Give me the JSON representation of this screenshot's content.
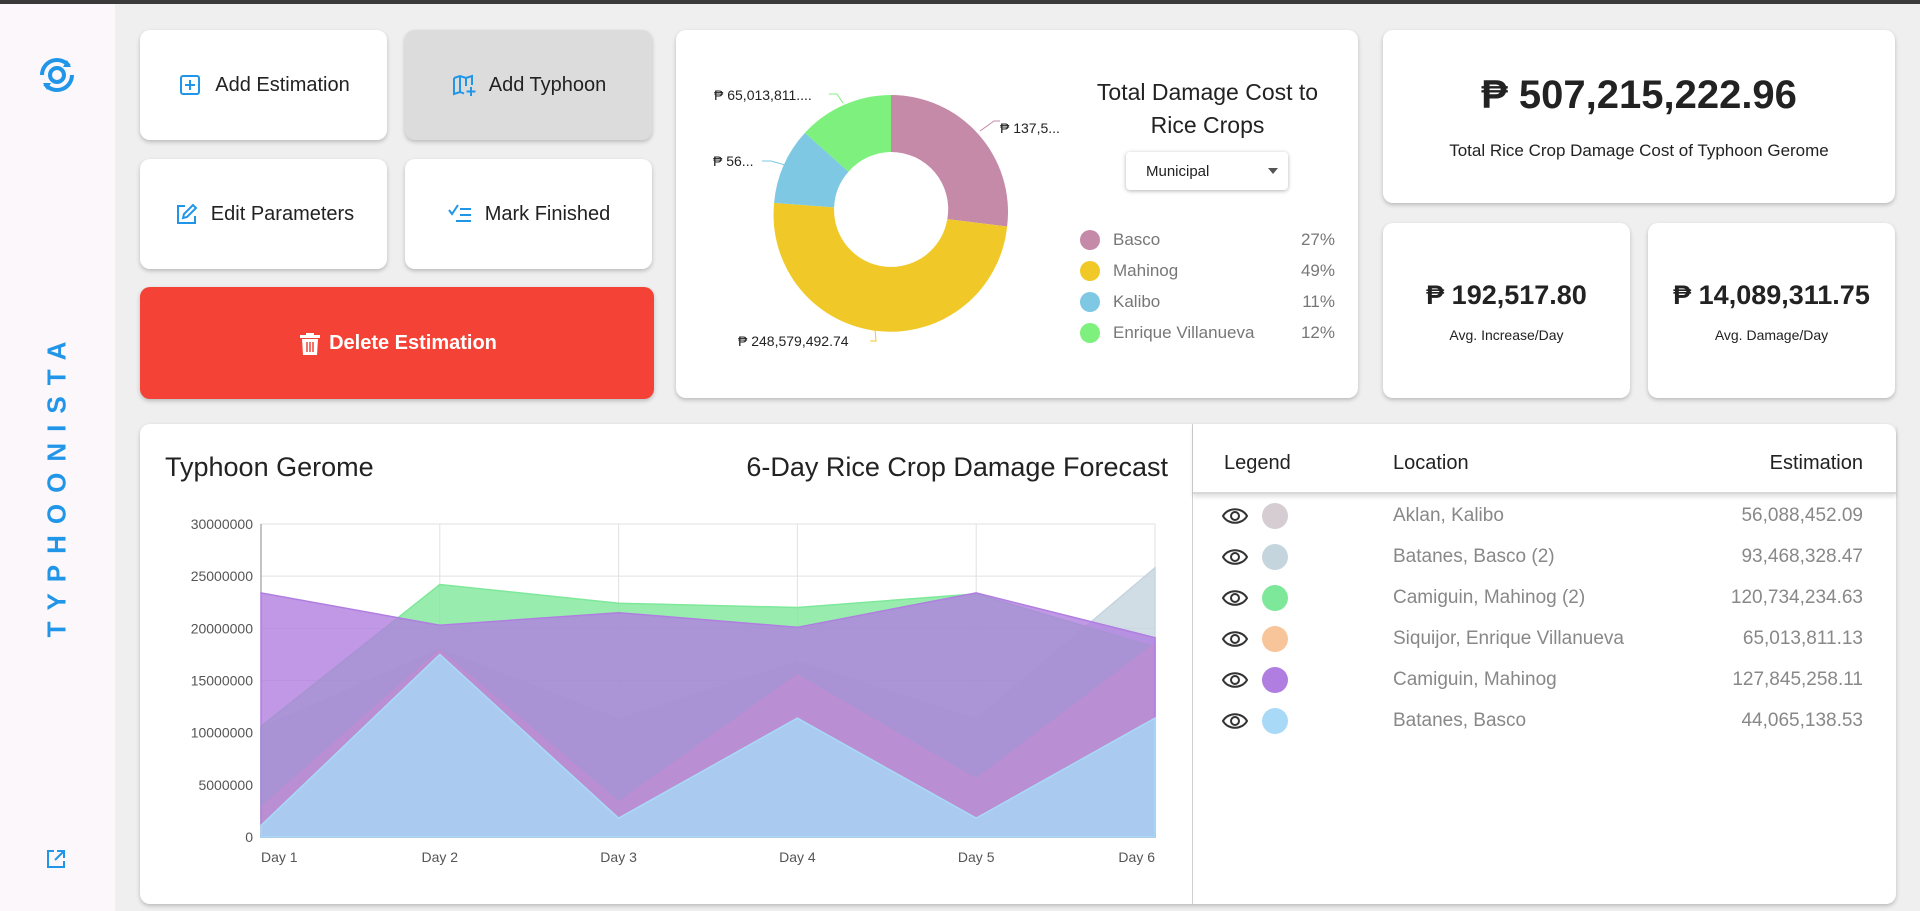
{
  "app": {
    "brand": "TYPHOONISTA"
  },
  "actions": {
    "add_estimation": "Add Estimation",
    "add_typhoon": "Add Typhoon",
    "edit_parameters": "Edit Parameters",
    "mark_finished": "Mark Finished",
    "delete_estimation": "Delete Estimation"
  },
  "donut": {
    "title": "Total Damage Cost to Rice Crops",
    "filter": "Municipal",
    "slice_labels": [
      "₱ 137,5...",
      "₱ 248,579,492.74",
      "₱ 56...",
      "₱ 65,013,811...."
    ],
    "legend": [
      {
        "name": "Basco",
        "pct": "27%",
        "color": "#c48aa8"
      },
      {
        "name": "Mahinog",
        "pct": "49%",
        "color": "#f0c928"
      },
      {
        "name": "Kalibo",
        "pct": "11%",
        "color": "#7ec8e3"
      },
      {
        "name": "Enrique Villanueva",
        "pct": "12%",
        "color": "#7df07d"
      }
    ]
  },
  "stats": {
    "total_value": "₱ 507,215,222.96",
    "total_label": "Total Rice Crop Damage Cost of Typhoon Gerome",
    "avg_increase_value": "₱ 192,517.80",
    "avg_increase_label": "Avg. Increase/Day",
    "avg_damage_value": "₱ 14,089,311.75",
    "avg_damage_label": "Avg. Damage/Day"
  },
  "chart": {
    "title": "Typhoon Gerome",
    "subtitle": "6-Day Rice Crop Damage Forecast"
  },
  "chart_data": {
    "type": "area",
    "categories": [
      "Day 1",
      "Day 2",
      "Day 3",
      "Day 4",
      "Day 5",
      "Day 6"
    ],
    "ylim": [
      0,
      30000000
    ],
    "yticks": [
      0,
      5000000,
      10000000,
      15000000,
      20000000,
      25000000,
      30000000
    ],
    "grid": true,
    "series": [
      {
        "color": "#d5cdd1",
        "values": [
          10500000,
          17900000,
          3300000,
          15500000,
          5500000,
          19200000
        ]
      },
      {
        "color": "#c5d5de",
        "values": [
          10400000,
          18000000,
          11300000,
          16800000,
          11300000,
          25800000
        ]
      },
      {
        "color": "#7ee89a",
        "values": [
          10600000,
          24200000,
          22400000,
          22000000,
          23300000,
          18200000
        ]
      },
      {
        "color": "#f8c49a",
        "values": [
          2800000,
          17900000,
          3300000,
          15500000,
          5500000,
          18500000
        ]
      },
      {
        "color": "#b07ee0",
        "values": [
          23400000,
          20300000,
          21500000,
          20100000,
          23400000,
          19100000
        ]
      },
      {
        "color": "#a8daf8",
        "values": [
          1100000,
          17500000,
          1800000,
          11400000,
          1800000,
          11400000
        ]
      }
    ]
  },
  "table": {
    "headers": {
      "legend": "Legend",
      "location": "Location",
      "estimation": "Estimation"
    },
    "rows": [
      {
        "location": "Aklan, Kalibo",
        "estimation": "56,088,452.09",
        "color": "#d5cdd1"
      },
      {
        "location": "Batanes, Basco (2)",
        "estimation": "93,468,328.47",
        "color": "#c5d5de"
      },
      {
        "location": "Camiguin, Mahinog (2)",
        "estimation": "120,734,234.63",
        "color": "#7ee89a"
      },
      {
        "location": "Siquijor, Enrique Villanueva",
        "estimation": "65,013,811.13",
        "color": "#f8c49a"
      },
      {
        "location": "Camiguin, Mahinog",
        "estimation": "127,845,258.11",
        "color": "#b07ee0"
      },
      {
        "location": "Batanes, Basco",
        "estimation": "44,065,138.53",
        "color": "#a8daf8"
      }
    ]
  }
}
